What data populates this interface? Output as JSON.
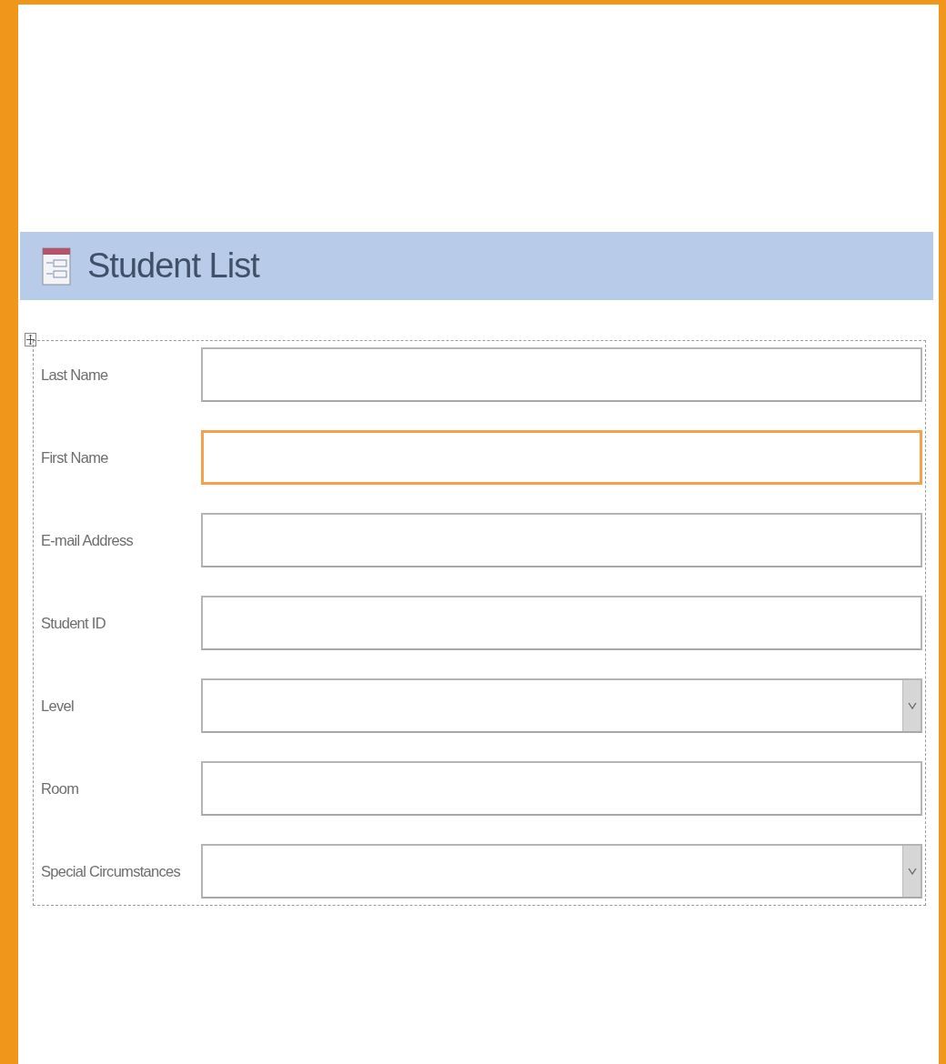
{
  "header": {
    "title": "Student List"
  },
  "fields": [
    {
      "label": "Last Name",
      "kind": "text",
      "focused": false
    },
    {
      "label": "First Name",
      "kind": "text",
      "focused": true
    },
    {
      "label": "E-mail Address",
      "kind": "text",
      "focused": false
    },
    {
      "label": "Student ID",
      "kind": "text",
      "focused": false
    },
    {
      "label": "Level",
      "kind": "combo",
      "focused": false
    },
    {
      "label": "Room",
      "kind": "text",
      "focused": false
    },
    {
      "label": "Special Circumstances",
      "kind": "combo",
      "focused": false
    }
  ]
}
